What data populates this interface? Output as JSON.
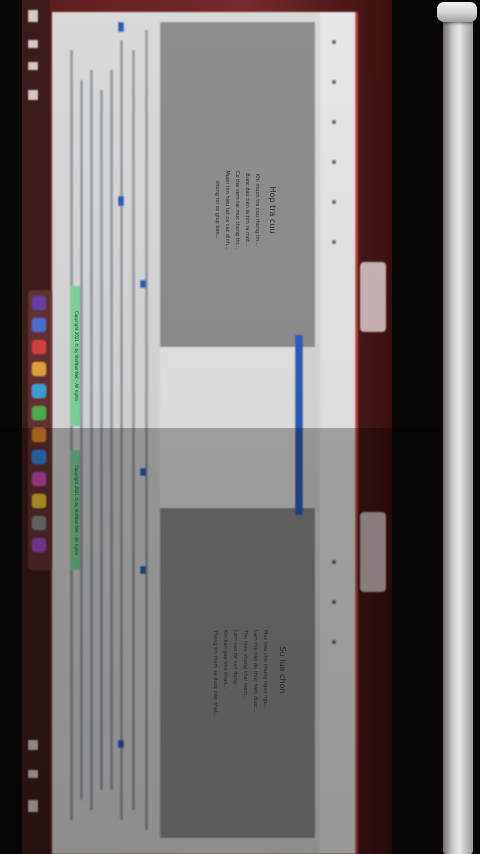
{
  "photo": {
    "subject": "laptop-screen-photo",
    "left_slide": {
      "title": "Hop tra cuu",
      "lines": [
        "Khi muon tra cuu thong tin...",
        "Buoc dau tien la tim ra mot...",
        "Co the xem tai muc thong tin...",
        "Muon tim hieu tat ca cac dinh...",
        "chung toi se giup ban..."
      ]
    },
    "right_slide": {
      "title": "Su lua chon",
      "lines": [
        "Muc tieu cho nhung ngon ngu...",
        "Lam the nao de thuc hien duoc...",
        "Tim hieu nhung khai niem...",
        "Lam sao de van dung...",
        "Khi ban gap kho khan...",
        "Thong tin them se duoc cap nhat..."
      ]
    },
    "green_badge_1": "Copyright 2021 © by VietNamNet – All rights",
    "green_badge_2": "Copyright 2021 © by VietNamNet – All rights",
    "dock_label": "",
    "colors": {
      "frame": "#0b0606",
      "screen_red": "#8a3a3a",
      "slide_gray": "#8f8f8f",
      "doc_white": "#dcdcdc",
      "accent_blue": "#2a5fb8",
      "badge_green": "#7fd49a"
    }
  },
  "scrollbar": {
    "level": 0.0
  }
}
